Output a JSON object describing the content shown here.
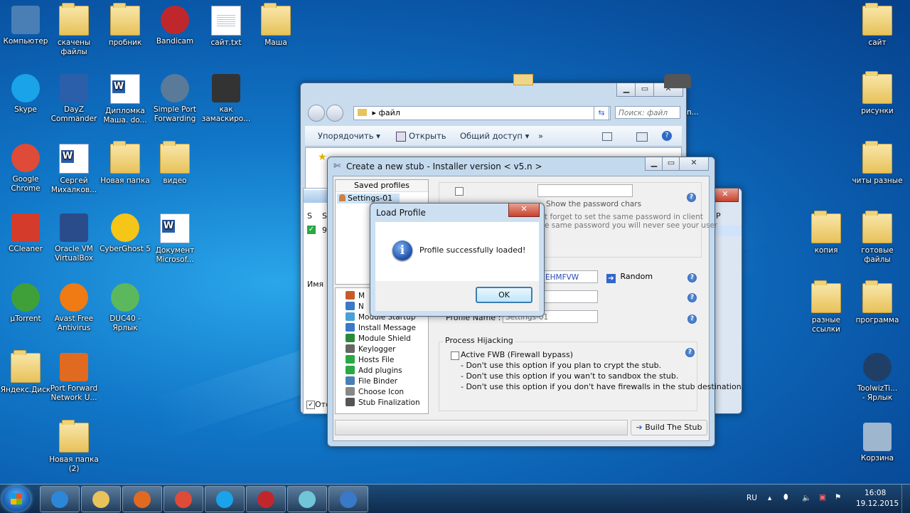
{
  "desktop": {
    "icons_left": [
      {
        "id": "computer",
        "label": "Компьютер",
        "icon": "computer-icon"
      },
      {
        "id": "downloads",
        "label": "скачены\nфайлы",
        "icon": "folder-icon"
      },
      {
        "id": "probnik",
        "label": "пробник",
        "icon": "folder-icon"
      },
      {
        "id": "bandicam",
        "label": "Bandicam",
        "icon": "bandicam-icon"
      },
      {
        "id": "site-txt",
        "label": "сайт.txt",
        "icon": "text-file-icon"
      },
      {
        "id": "masha",
        "label": "Маша",
        "icon": "folder-icon"
      },
      {
        "id": "skype",
        "label": "Skype",
        "icon": "skype-icon"
      },
      {
        "id": "dayz",
        "label": "DayZ\nCommander",
        "icon": "dayz-icon"
      },
      {
        "id": "diploma",
        "label": "Дипломка\nМаша. do...",
        "icon": "word-doc-icon"
      },
      {
        "id": "simpleport",
        "label": "Simple Port\nForwarding",
        "icon": "globe-icon"
      },
      {
        "id": "kak",
        "label": "как\nзамаскиро...",
        "icon": "video-icon"
      },
      {
        "id": "chrome",
        "label": "Google\nChrome",
        "icon": "chrome-icon"
      },
      {
        "id": "sergey",
        "label": "Сергей\nМихалков...",
        "icon": "word-doc-icon"
      },
      {
        "id": "newfolder",
        "label": "Новая папка",
        "icon": "folder-icon"
      },
      {
        "id": "video",
        "label": "видео",
        "icon": "folder-icon"
      },
      {
        "id": "ccleaner",
        "label": "CCleaner",
        "icon": "ccleaner-icon"
      },
      {
        "id": "virtualbox",
        "label": "Oracle VM\nVirtualBox",
        "icon": "virtualbox-icon"
      },
      {
        "id": "cyberghost",
        "label": "CyberGhost 5",
        "icon": "cyberghost-icon"
      },
      {
        "id": "msdoc",
        "label": "Документ\nMicrosof...",
        "icon": "word-doc-icon"
      },
      {
        "id": "utorrent",
        "label": "µTorrent",
        "icon": "utorrent-icon"
      },
      {
        "id": "avast",
        "label": "Avast Free\nAntivirus",
        "icon": "avast-icon"
      },
      {
        "id": "duc",
        "label": "DUC40 -\nЯрлык",
        "icon": "duc-icon"
      },
      {
        "id": "yadisk",
        "label": "Яндекс.Диск",
        "icon": "folder-icon"
      },
      {
        "id": "portforward",
        "label": "Port Forward\nNetwork U...",
        "icon": "portforward-icon"
      },
      {
        "id": "newfolder2",
        "label": "Новая папка\n(2)",
        "icon": "folder-icon"
      }
    ],
    "icons_right": [
      {
        "id": "site",
        "label": "сайт",
        "icon": "folder-icon"
      },
      {
        "id": "pics",
        "label": "рисунки",
        "icon": "folder-icon"
      },
      {
        "id": "cheats",
        "label": "читы разные",
        "icon": "folder-icon"
      },
      {
        "id": "copy",
        "label": "копия",
        "icon": "folder-icon"
      },
      {
        "id": "ready",
        "label": "готовые\nфайлы",
        "icon": "folder-icon"
      },
      {
        "id": "links",
        "label": "разные\nссылки",
        "icon": "folder-icon"
      },
      {
        "id": "program",
        "label": "программа",
        "icon": "folder-icon"
      },
      {
        "id": "toolwiz",
        "label": "ToolwizTi...\n- Ярлык",
        "icon": "toolwiz-icon"
      },
      {
        "id": "recycle",
        "label": "Корзина",
        "icon": "recycle-bin-icon"
      }
    ]
  },
  "explorer": {
    "address": "файл",
    "search_placeholder": "Поиск: файл",
    "commands": {
      "organize": "Упорядочить ▾",
      "open": "Открыть",
      "share": "Общий доступ ▾",
      "more": "»"
    },
    "trail_text": "n..."
  },
  "bg_window": {
    "col_s1": "S",
    "col_s2": "S",
    "num": "9",
    "name_col": "Имя",
    "bottom_check": "Отс",
    "side_text": "P"
  },
  "stub": {
    "title": "Create a new stub - Installer version < v5.n >",
    "saved_profiles": "Saved profiles",
    "profile_item": "Settings-01",
    "password_hint1": "Show the password chars",
    "password_hint2": "t forget to set the same password in client",
    "password_hint3": "e same password you will never see your user",
    "mutex_value": "EHMFVW",
    "random_label": "Random",
    "profile_name_label": "Profile Name :",
    "profile_name_value": "Settings-01",
    "hijack_group": "Process Hijacking",
    "fwb_label": "Active FWB (Firewall bypass)",
    "fwb_notes": [
      "- Don't use this option if you plan to crypt the stub.",
      "- Don't use this option if you wan't to sandbox the stub.",
      "- Don't use this option if you don't have firewalls in the stub destination."
    ],
    "tree": [
      {
        "label": "M",
        "icon": "house-icon"
      },
      {
        "label": "N",
        "icon": "network-icon"
      },
      {
        "label": "Module Startup",
        "icon": "startup-icon"
      },
      {
        "label": "Install Message",
        "icon": "message-icon"
      },
      {
        "label": "Module Shield",
        "icon": "shield-icon"
      },
      {
        "label": "Keylogger",
        "icon": "keyboard-icon"
      },
      {
        "label": "Hosts File",
        "icon": "hosts-icon"
      },
      {
        "label": "Add plugins",
        "icon": "plugin-icon"
      },
      {
        "label": "File Binder",
        "icon": "binder-icon"
      },
      {
        "label": "Choose Icon",
        "icon": "icon-chooser-icon"
      },
      {
        "label": "Stub Finalization",
        "icon": "finalize-icon"
      }
    ],
    "build_label": "Build The Stub"
  },
  "dialog": {
    "title": "Load Profile",
    "message": "Profile successfully loaded!",
    "ok": "OK",
    "close": "✕"
  },
  "taskbar": {
    "apps": [
      {
        "id": "ie",
        "icon": "ie-icon",
        "color": "#2c87d8"
      },
      {
        "id": "explorer",
        "icon": "folder-icon",
        "color": "#e8c25a"
      },
      {
        "id": "media",
        "icon": "media-player-icon",
        "color": "#e06a20"
      },
      {
        "id": "chrome",
        "icon": "chrome-icon",
        "color": "#de4b39"
      },
      {
        "id": "skype",
        "icon": "skype-icon",
        "color": "#1aa3e8"
      },
      {
        "id": "bandicam",
        "icon": "bandicam-icon",
        "color": "#c0272d"
      },
      {
        "id": "tool",
        "icon": "tool-icon",
        "color": "#70c6d8"
      },
      {
        "id": "njrat",
        "icon": "network-app-icon",
        "color": "#3a78c8"
      }
    ],
    "lang": "RU",
    "time": "16:08",
    "date": "19.12.2015"
  }
}
